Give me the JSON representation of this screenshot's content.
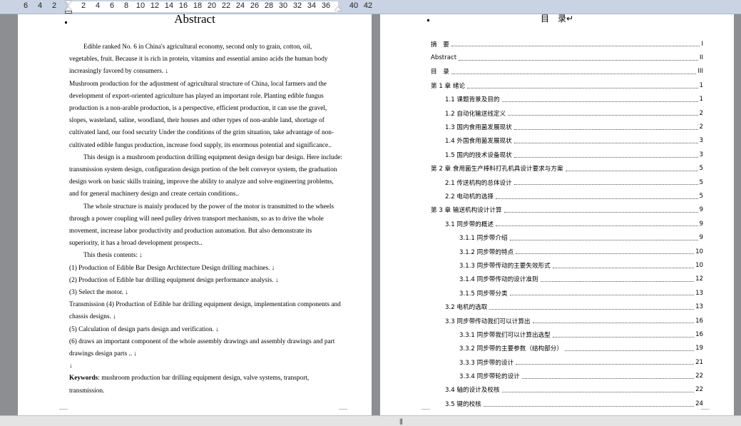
{
  "ruler": {
    "left_numbers": [
      "6",
      "4",
      "2"
    ],
    "main_numbers": [
      "2",
      "4",
      "6",
      "8",
      "10",
      "12",
      "14",
      "16",
      "18",
      "20",
      "22",
      "24",
      "26",
      "28",
      "30",
      "32",
      "34",
      "36"
    ],
    "right_numbers": [
      "40",
      "42"
    ]
  },
  "left_page": {
    "title": "Abstract",
    "paragraphs": [
      {
        "text": "Edible ranked No. 6 in China's agricultural economy, second only to grain, cotton, oil, vegetables, fruit. Because it is rich in protein, vitamins and essential amino acids the human body increasingly favored by consumers. ↓",
        "indent": true
      },
      {
        "text": "Mushroom production for the adjustment of agricultural structure of China, local farmers and the development of export-oriented agriculture has played an important role. Planting edible fungus production is a non-arable production, is a perspective, efficient production, it can use the gravel, slopes, wasteland, saline, woodland, their houses and other types of non-arable land, shortage of cultivated land, our food security Under the conditions of the grim situation, take advantage of non-cultivated edible fungus production, increase food supply, its enormous potential and significance..",
        "indent": false
      },
      {
        "text": "This design is a mushroom production drilling equipment design design bar design. Here include: transmission system design, configuration design portion of the belt conveyor system, the graduation design work on basic skills training, improve the ability to analyze and solve engineering problems, and for general machinery design and create certain conditions..",
        "indent": true
      },
      {
        "text": "The whole structure is mainly produced by the power of the motor is transmitted to the wheels through a power coupling will need pulley driven transport mechanism, so as to drive the whole movement, increase labor productivity and production automation. But also demonstrate its superiority, it has a broad development prospects..",
        "indent": true
      },
      {
        "text": "This thesis contents: ↓",
        "indent": true
      },
      {
        "text": "(1) Production of Edible Bar Design Architecture Design drilling machines. ↓",
        "indent": false
      },
      {
        "text": "(2) Production of Edible bar drilling equipment design performance analysis. ↓",
        "indent": false
      },
      {
        "text": "(3) Select the motor. ↓",
        "indent": false
      },
      {
        "text": "Transmission (4) Production of Edible bar drilling equipment design, implementation components and chassis designs. ↓",
        "indent": false
      },
      {
        "text": "(5) Calculation of design parts design and verification. ↓",
        "indent": false
      },
      {
        "text": "(6) draws an important component of the whole assembly drawings and assembly drawings and part drawings design parts .. ↓",
        "indent": false
      },
      {
        "text": "↓",
        "indent": false
      }
    ],
    "keywords_label": "Keywords",
    "keywords_text": ": mushroom production bar drilling equipment design, valve systems, transport, transmission."
  },
  "right_page": {
    "title": "目　录↵",
    "entries": [
      {
        "label": "摘　要",
        "page": "I",
        "level": 1
      },
      {
        "label": "Abstract",
        "page": "II",
        "level": 1
      },
      {
        "label": "目　录",
        "page": "III",
        "level": 1
      },
      {
        "label": "第 1 章  绪论",
        "page": "1",
        "level": 1
      },
      {
        "label": "1.1 课题背景及目的",
        "page": "1",
        "level": 2
      },
      {
        "label": "1.2 自动化输送线定义",
        "page": "2",
        "level": 2
      },
      {
        "label": "1.3  国内食用菌发展现状",
        "page": "2",
        "level": 2
      },
      {
        "label": "1.4  外国食用菌发展现状",
        "page": "3",
        "level": 2
      },
      {
        "label": "1.5  国内的技术设备现状",
        "page": "3",
        "level": 2
      },
      {
        "label": "第 2 章  食用菌生产棒料打孔机具设计要求与方案",
        "page": "5",
        "level": 1
      },
      {
        "label": "2.1  传送机构的总体设计",
        "page": "5",
        "level": 2
      },
      {
        "label": "2.2  电动机的选择",
        "page": "5",
        "level": 2
      },
      {
        "label": "第 3 章  输送机构设计计算",
        "page": "9",
        "level": 1
      },
      {
        "label": "3.1 同步带的概述",
        "page": "9",
        "level": 2
      },
      {
        "label": "3.1.1  同步带介绍",
        "page": "9",
        "level": 3
      },
      {
        "label": "3.1.2    同步带的特点",
        "page": "10",
        "level": 3
      },
      {
        "label": "3.1.3    同步带传动的主要失效形式",
        "page": "10",
        "level": 3
      },
      {
        "label": "3.1.4    同步带传动的设计准则",
        "page": "12",
        "level": 3
      },
      {
        "label": "3.1.5    同步带分类",
        "page": "13",
        "level": 3
      },
      {
        "label": "3.2    电机的选取",
        "page": "13",
        "level": 2
      },
      {
        "label": "3.3  同步带传动我们可以计算出",
        "page": "16",
        "level": 2
      },
      {
        "label": "3.3.1    同步带我们可以计算出选型",
        "page": "16",
        "level": 3
      },
      {
        "label": "3.3.2    同步带的主要参数（结构部分）",
        "page": "19",
        "level": 3
      },
      {
        "label": "3.3.3    同步带的设计",
        "page": "21",
        "level": 3
      },
      {
        "label": "3.3.4    同步带轮的设计",
        "page": "22",
        "level": 3
      },
      {
        "label": "3.4    轴的设计及校核",
        "page": "22",
        "level": 2
      },
      {
        "label": "3.5    键的校核",
        "page": "24",
        "level": 2
      }
    ]
  },
  "statusbar": {
    "splitter_glyph": "|||"
  }
}
